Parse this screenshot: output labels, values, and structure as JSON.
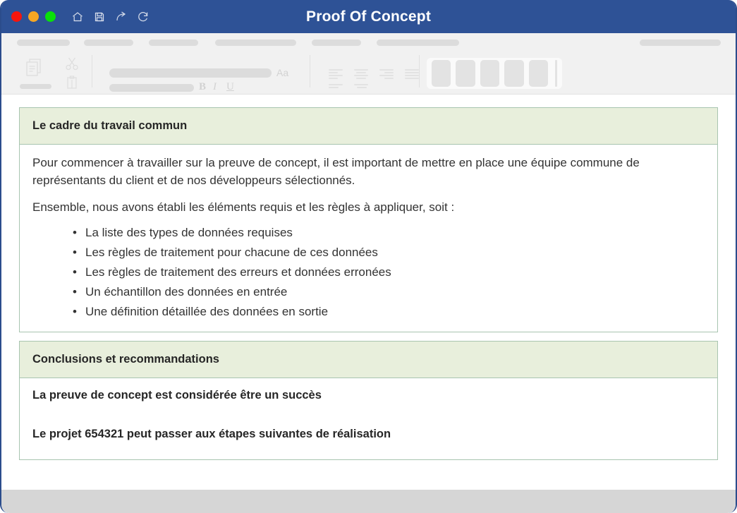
{
  "window": {
    "title": "Proof Of Concept",
    "traffic_lights": [
      {
        "name": "close",
        "color": "#f5150d"
      },
      {
        "name": "minimize",
        "color": "#f5a623"
      },
      {
        "name": "maximize",
        "color": "#0ae00a"
      }
    ],
    "quick_icons": [
      "home-icon",
      "save-icon",
      "redo-icon",
      "refresh-icon"
    ],
    "titlebar_color": "#2e5296"
  },
  "ribbon": {
    "tab_placeholders": 7,
    "clipboard_icons": [
      "copy-icon",
      "cut-icon",
      "paste-icon"
    ],
    "font_letters": {
      "aa": "Aa",
      "bold": "B",
      "italic": "I",
      "underline": "U"
    },
    "style_gallery_items": 5
  },
  "document": {
    "sections": [
      {
        "id": "framework",
        "header": "Le cadre du travail commun",
        "paragraphs": [
          "Pour commencer à travailler sur la preuve de concept, il est important de mettre en place une équipe commune de représentants du client et de nos développeurs sélectionnés.",
          "Ensemble, nous avons établi les éléments requis et les règles à appliquer, soit :"
        ],
        "bullets": [
          "La liste des types de données requises",
          "Les règles de traitement pour chacune de ces données",
          "Les règles de traitement des erreurs et données erronées",
          "Un échantillon des données en entrée",
          "Une définition détaillée des données en sortie"
        ],
        "bullet_glyph": "•"
      },
      {
        "id": "conclusions",
        "header": "Conclusions et recommandations",
        "lines": [
          "La preuve de concept est considérée être un succès",
          "Le projet 654321 peut passer aux étapes suivantes de réalisation"
        ]
      }
    ],
    "colors": {
      "section_header_bg": "#e8efdc",
      "table_border": "#a8c4b0",
      "body_text": "#333333"
    }
  }
}
